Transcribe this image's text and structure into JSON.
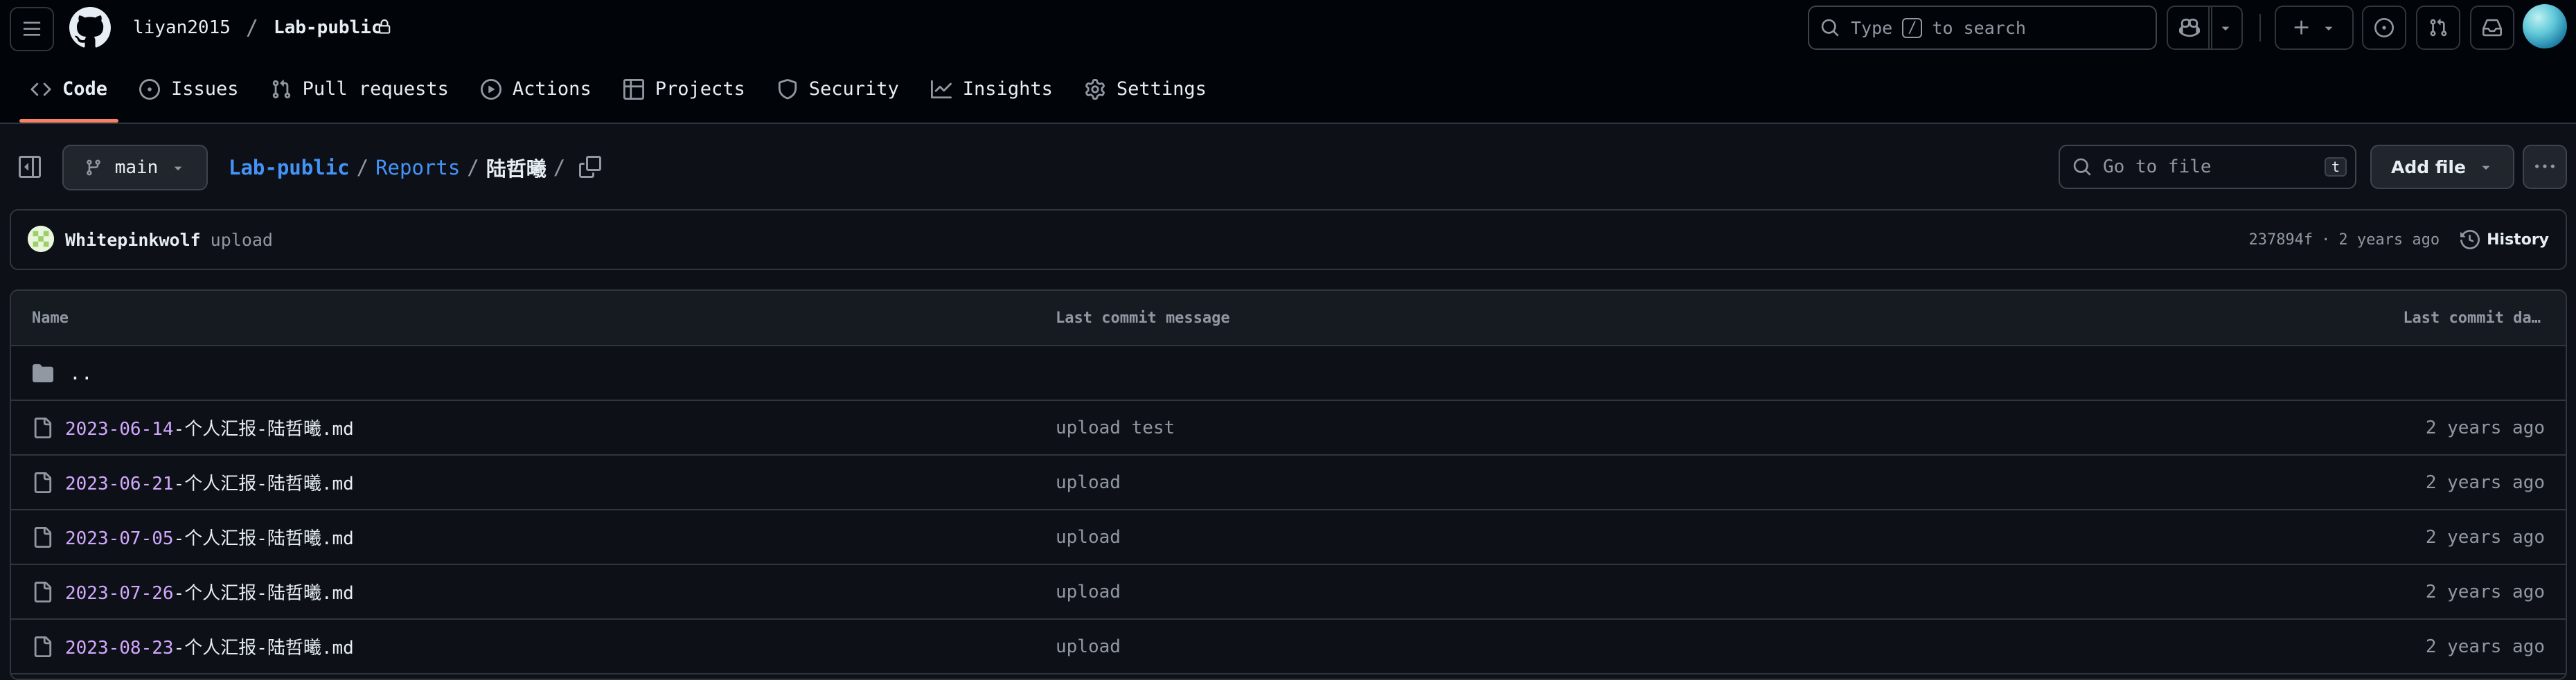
{
  "header": {
    "owner": "liyan2015",
    "separator": "/",
    "repo": "Lab-public",
    "search_prefix": "Type",
    "search_key": "/",
    "search_suffix": "to search"
  },
  "tabs": [
    {
      "label": "Code",
      "icon": "code-icon"
    },
    {
      "label": "Issues",
      "icon": "issue-icon"
    },
    {
      "label": "Pull requests",
      "icon": "pull-request-icon"
    },
    {
      "label": "Actions",
      "icon": "play-icon"
    },
    {
      "label": "Projects",
      "icon": "table-icon"
    },
    {
      "label": "Security",
      "icon": "shield-icon"
    },
    {
      "label": "Insights",
      "icon": "graph-icon"
    },
    {
      "label": "Settings",
      "icon": "gear-icon"
    }
  ],
  "path": {
    "branch": "main",
    "crumbs": [
      "Lab-public",
      "Reports"
    ],
    "current": "陆哲曦",
    "sep": "/",
    "goto_placeholder": "Go to file",
    "goto_key": "t",
    "add_file": "Add file"
  },
  "commit": {
    "author": "Whitepinkwolf",
    "message": "upload",
    "hash": "237894f",
    "dot": "·",
    "time": "2 years ago",
    "history": "History"
  },
  "table": {
    "col_name": "Name",
    "col_message": "Last commit message",
    "col_date": "Last commit da…",
    "parent": "..",
    "rows": [
      {
        "date": "2023-06-14",
        "rest": "-个人汇报-陆哲曦.md",
        "message": "upload test",
        "time": "2 years ago"
      },
      {
        "date": "2023-06-21",
        "rest": "-个人汇报-陆哲曦.md",
        "message": "upload",
        "time": "2 years ago"
      },
      {
        "date": "2023-07-05",
        "rest": "-个人汇报-陆哲曦.md",
        "message": "upload",
        "time": "2 years ago"
      },
      {
        "date": "2023-07-26",
        "rest": "-个人汇报-陆哲曦.md",
        "message": "upload",
        "time": "2 years ago"
      },
      {
        "date": "2023-08-23",
        "rest": "-个人汇报-陆哲曦.md",
        "message": "upload",
        "time": "2 years ago"
      }
    ]
  }
}
